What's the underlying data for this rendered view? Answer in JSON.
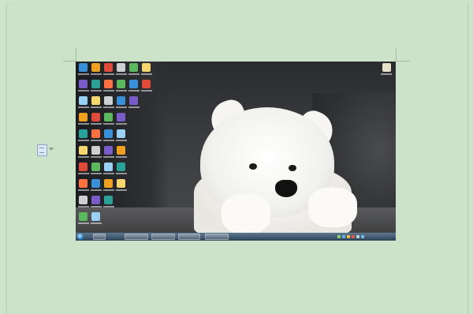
{
  "document": {
    "insert_options_icon": "document-icon",
    "insert_options_arrow": "chevron-down-icon"
  },
  "screenshot": {
    "content": "desktop-screenshot",
    "wallpaper": "white-dog-wallpaper",
    "taskbar": {
      "start_icon": "windows-start-icon",
      "clock_time": "",
      "clock_date": ""
    }
  },
  "colors": {
    "page_background": "#cfe3cc",
    "taskbar": "#2e4458"
  }
}
